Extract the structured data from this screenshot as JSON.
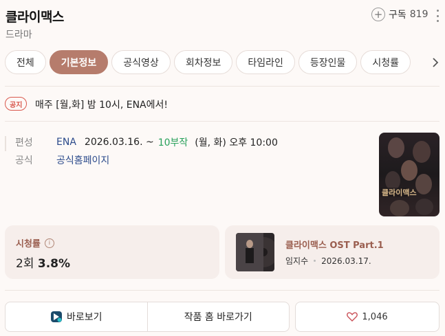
{
  "header": {
    "title": "클라이맥스",
    "category": "드라마",
    "subscribe_label": "구독",
    "subscribe_count": "819"
  },
  "tabs": [
    {
      "label": "전체",
      "active": false
    },
    {
      "label": "기본정보",
      "active": true
    },
    {
      "label": "공식영상",
      "active": false
    },
    {
      "label": "회차정보",
      "active": false
    },
    {
      "label": "타임라인",
      "active": false
    },
    {
      "label": "등장인물",
      "active": false
    },
    {
      "label": "시청률",
      "active": false
    }
  ],
  "notice": {
    "badge": "공지",
    "text": "매주 [월,화] 밤 10시, ENA에서!"
  },
  "info": {
    "schedule_label": "편성",
    "channel": "ENA",
    "start_date": "2026.03.16. ~",
    "episodes": "10부작",
    "airtime": "(월, 화) 오후 10:00",
    "official_label": "공식",
    "official_link": "공식홈페이지"
  },
  "ratings": {
    "label": "시청률",
    "episode": "2회",
    "value": "3.8%"
  },
  "ost": {
    "title": "클라이맥스 OST Part.1",
    "artist": "임지수",
    "date": "2026.03.17."
  },
  "actions": {
    "watch_label": "바로보기",
    "home_label": "작품 홈 바로가기",
    "like_count": "1,046"
  },
  "colors": {
    "accent": "#b67c6c",
    "link_blue": "#2b4a8b",
    "episodes_green": "#27a05a",
    "notice_red": "#d9584d"
  }
}
